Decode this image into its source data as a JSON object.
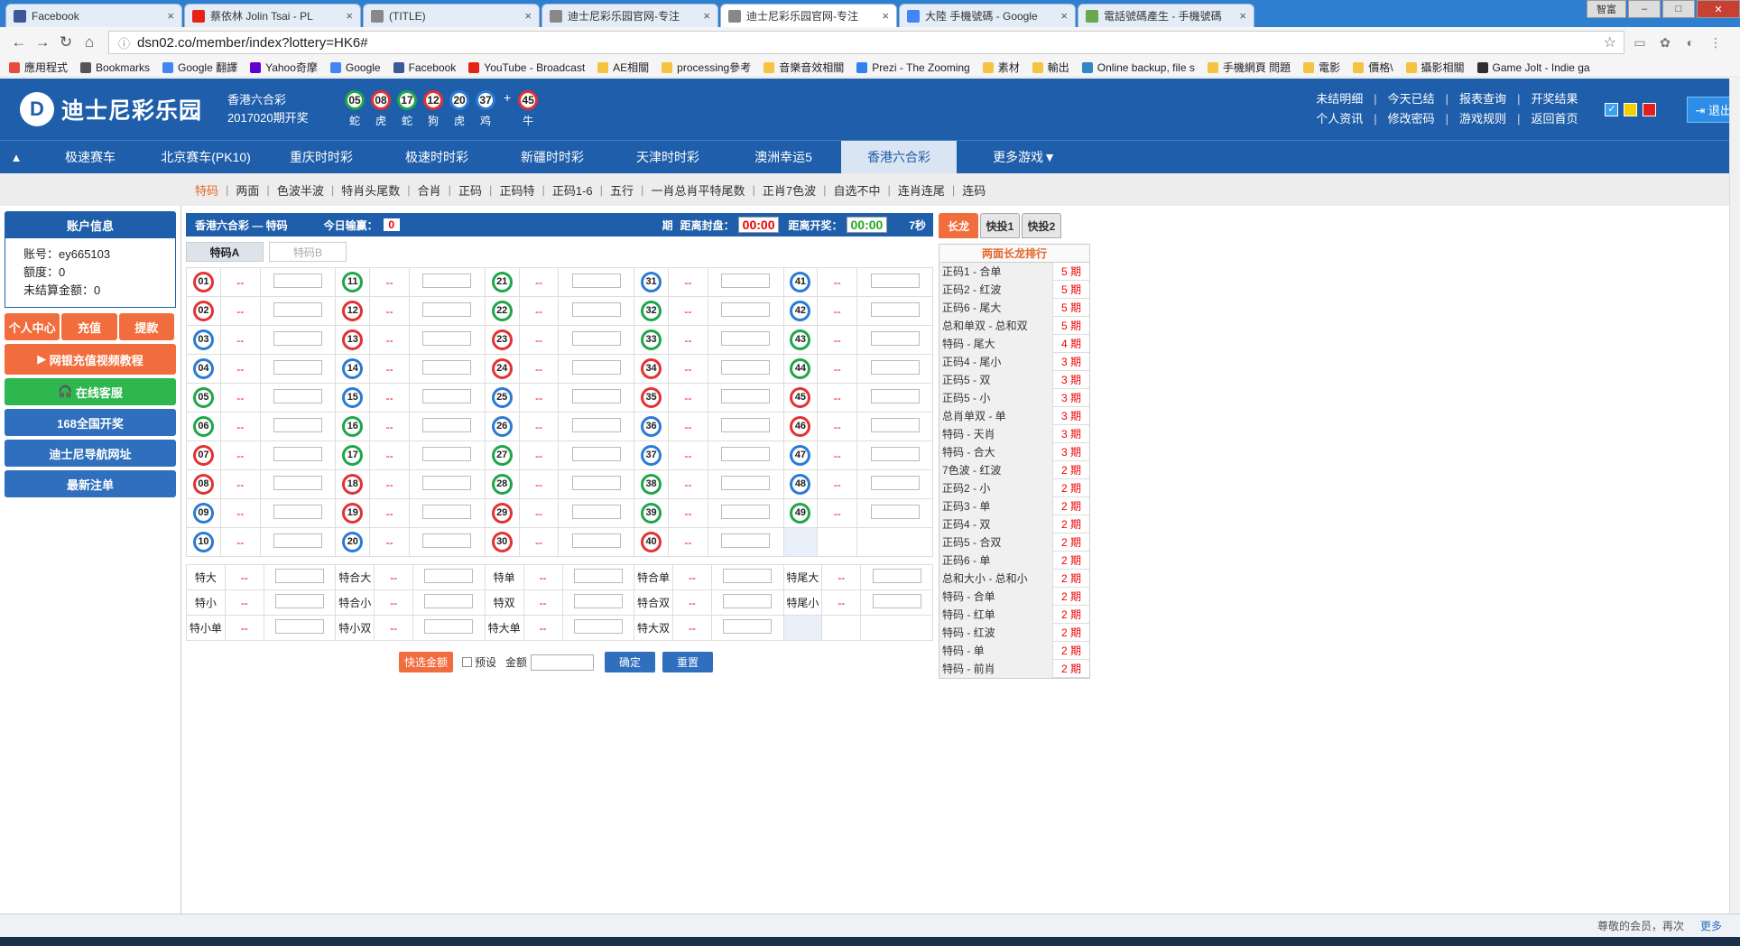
{
  "browser": {
    "tabs": [
      {
        "title": "Facebook",
        "icon": "facebook-icon",
        "color": "#3b5998"
      },
      {
        "title": "蔡依林 Jolin Tsai - PL",
        "icon": "youtube-icon",
        "color": "#e62117"
      },
      {
        "title": "(TITLE)",
        "icon": "page-icon",
        "color": "#888888"
      },
      {
        "title": "迪士尼彩乐园官网-专注",
        "icon": "page-icon",
        "color": "#888888"
      },
      {
        "title": "迪士尼彩乐园官网-专注",
        "icon": "page-icon",
        "color": "#888888",
        "active": true
      },
      {
        "title": "大陸 手機號碼 - Google",
        "icon": "google-icon",
        "color": "#4285f4"
      },
      {
        "title": "電話號碼產生 - 手機號碼",
        "icon": "page-icon",
        "color": "#6aa84f"
      }
    ],
    "url": "dsn02.co/member/index?lottery=HK6#",
    "window_controls": [
      "智富",
      "–",
      "□",
      "✕"
    ],
    "bookmarks": [
      {
        "label": "應用程式",
        "color": "#e74c3c"
      },
      {
        "label": "Bookmarks",
        "color": "#555555"
      },
      {
        "label": "Google 翻譯",
        "color": "#4285f4"
      },
      {
        "label": "Yahoo奇摩",
        "color": "#6001d2"
      },
      {
        "label": "Google",
        "color": "#4285f4"
      },
      {
        "label": "Facebook",
        "color": "#3b5998"
      },
      {
        "label": "YouTube - Broadcast",
        "color": "#e62117"
      },
      {
        "label": "AE相關",
        "color": "#f5c242"
      },
      {
        "label": "processing參考",
        "color": "#f5c242"
      },
      {
        "label": "音樂音效相關",
        "color": "#f5c242"
      },
      {
        "label": "Prezi - The Zooming",
        "color": "#3181f0"
      },
      {
        "label": "素材",
        "color": "#f5c242"
      },
      {
        "label": "輸出",
        "color": "#f5c242"
      },
      {
        "label": "Online backup, file s",
        "color": "#2f86c9"
      },
      {
        "label": "手機網頁 問題",
        "color": "#f5c242"
      },
      {
        "label": "電影",
        "color": "#f5c242"
      },
      {
        "label": "價格\\",
        "color": "#f5c242"
      },
      {
        "label": "攝影相關",
        "color": "#f5c242"
      },
      {
        "label": "Game Jolt - Indie ga",
        "color": "#2f2f2f"
      }
    ]
  },
  "site": {
    "logo_text": "迪士尼彩乐园",
    "logo_letter": "D",
    "latest_game": "香港六合彩",
    "latest_period": "2017020期开奖",
    "draw_balls": [
      {
        "n": "05",
        "z": "蛇",
        "c": "green"
      },
      {
        "n": "08",
        "z": "虎",
        "c": "red"
      },
      {
        "n": "17",
        "z": "蛇",
        "c": "green"
      },
      {
        "n": "12",
        "z": "狗",
        "c": "red"
      },
      {
        "n": "20",
        "z": "虎",
        "c": "blue"
      },
      {
        "n": "37",
        "z": "鸡",
        "c": "blue"
      }
    ],
    "special_ball": {
      "n": "45",
      "z": "牛",
      "c": "red"
    },
    "plus": "+",
    "links_row1": [
      "未结明细",
      "今天已结",
      "报表查询",
      "开奖结果"
    ],
    "links_row2": [
      "个人资讯",
      "修改密码",
      "游戏规则",
      "返回首页"
    ],
    "theme_colors": [
      "#3aa0f0",
      "#f5d000",
      "#e21d1d"
    ],
    "logout": "退出"
  },
  "game_nav": {
    "items": [
      "极速赛车",
      "北京赛车(PK10)",
      "重庆时时彩",
      "极速时时彩",
      "新疆时时彩",
      "天津时时彩",
      "澳洲幸运5",
      "香港六合彩"
    ],
    "active": "香港六合彩",
    "more": "更多游戏"
  },
  "sub_nav": [
    "特码",
    "两面",
    "色波半波",
    "特肖头尾数",
    "合肖",
    "正码",
    "正码特",
    "正码1-6",
    "五行",
    "一肖总肖平特尾数",
    "正肖7色波",
    "自选不中",
    "连肖连尾",
    "连码"
  ],
  "sidebar": {
    "header": "账户信息",
    "account_label": "账号：ey665103",
    "credit_label": "额度：0",
    "unsettled_label": "未结算金额：0",
    "btn_center": "个人中心",
    "btn_deposit": "充值",
    "btn_withdraw": "提款",
    "btn_video": "网银充值视频教程",
    "btn_service": "在线客服",
    "btn_168": "168全国开奖",
    "btn_nav": "迪士尼导航网址",
    "btn_latest": "最新注单"
  },
  "game": {
    "title": "香港六合彩 — 特码",
    "today_loss_label": "今日输赢：",
    "today_loss": "0",
    "period_label": "期",
    "close_label": "距离封盘：",
    "close_time": "00:00",
    "open_label": "距离开奖：",
    "open_time": "00:00",
    "seconds": "7秒",
    "subtab_a": "特码A",
    "subtab_b": "特码B",
    "odds_placeholder": "--",
    "numbers": [
      [
        "01",
        "red"
      ],
      [
        "02",
        "red"
      ],
      [
        "03",
        "blue"
      ],
      [
        "04",
        "blue"
      ],
      [
        "05",
        "green"
      ],
      [
        "06",
        "green"
      ],
      [
        "07",
        "red"
      ],
      [
        "08",
        "red"
      ],
      [
        "09",
        "blue"
      ],
      [
        "10",
        "blue"
      ],
      [
        "11",
        "green"
      ],
      [
        "12",
        "red"
      ],
      [
        "13",
        "red"
      ],
      [
        "14",
        "blue"
      ],
      [
        "15",
        "blue"
      ],
      [
        "16",
        "green"
      ],
      [
        "17",
        "green"
      ],
      [
        "18",
        "red"
      ],
      [
        "19",
        "red"
      ],
      [
        "20",
        "blue"
      ],
      [
        "21",
        "green"
      ],
      [
        "22",
        "green"
      ],
      [
        "23",
        "red"
      ],
      [
        "24",
        "red"
      ],
      [
        "25",
        "blue"
      ],
      [
        "26",
        "blue"
      ],
      [
        "27",
        "green"
      ],
      [
        "28",
        "green"
      ],
      [
        "29",
        "red"
      ],
      [
        "30",
        "red"
      ],
      [
        "31",
        "blue"
      ],
      [
        "32",
        "green"
      ],
      [
        "33",
        "green"
      ],
      [
        "34",
        "red"
      ],
      [
        "35",
        "red"
      ],
      [
        "36",
        "blue"
      ],
      [
        "37",
        "blue"
      ],
      [
        "38",
        "green"
      ],
      [
        "39",
        "green"
      ],
      [
        "40",
        "red"
      ],
      [
        "41",
        "blue"
      ],
      [
        "42",
        "blue"
      ],
      [
        "43",
        "green"
      ],
      [
        "44",
        "green"
      ],
      [
        "45",
        "red"
      ],
      [
        "46",
        "red"
      ],
      [
        "47",
        "blue"
      ],
      [
        "48",
        "blue"
      ],
      [
        "49",
        "green"
      ]
    ],
    "sides": [
      [
        "特大",
        "特合大",
        "特单",
        "特合单",
        "特尾大"
      ],
      [
        "特小",
        "特合小",
        "特双",
        "特合双",
        "特尾小"
      ],
      [
        "特小单",
        "特小双",
        "特大单",
        "特大双",
        ""
      ]
    ],
    "quick_amount": "快选金额",
    "preset": "预设",
    "amount_label": "金额",
    "confirm": "确定",
    "reset": "重置"
  },
  "right": {
    "tabs": [
      "长龙",
      "快投1",
      "快投2"
    ],
    "header": "两面长龙排行",
    "rows": [
      [
        "正码1 - 合单",
        "5 期"
      ],
      [
        "正码2 - 红波",
        "5 期"
      ],
      [
        "正码6 - 尾大",
        "5 期"
      ],
      [
        "总和单双 - 总和双",
        "5 期"
      ],
      [
        "特码 - 尾大",
        "4 期"
      ],
      [
        "正码4 - 尾小",
        "3 期"
      ],
      [
        "正码5 - 双",
        "3 期"
      ],
      [
        "正码5 - 小",
        "3 期"
      ],
      [
        "总肖单双 - 单",
        "3 期"
      ],
      [
        "特码 - 天肖",
        "3 期"
      ],
      [
        "特码 - 合大",
        "3 期"
      ],
      [
        "7色波 - 红波",
        "2 期"
      ],
      [
        "正码2 - 小",
        "2 期"
      ],
      [
        "正码3 - 单",
        "2 期"
      ],
      [
        "正码4 - 双",
        "2 期"
      ],
      [
        "正码5 - 合双",
        "2 期"
      ],
      [
        "正码6 - 单",
        "2 期"
      ],
      [
        "总和大小 - 总和小",
        "2 期"
      ],
      [
        "特码 - 合单",
        "2 期"
      ],
      [
        "特码 - 红单",
        "2 期"
      ],
      [
        "特码 - 红波",
        "2 期"
      ],
      [
        "特码 - 单",
        "2 期"
      ],
      [
        "特码 - 前肖",
        "2 期"
      ]
    ]
  },
  "footer": {
    "text": "尊敬的会员，再次",
    "more": "更多"
  }
}
